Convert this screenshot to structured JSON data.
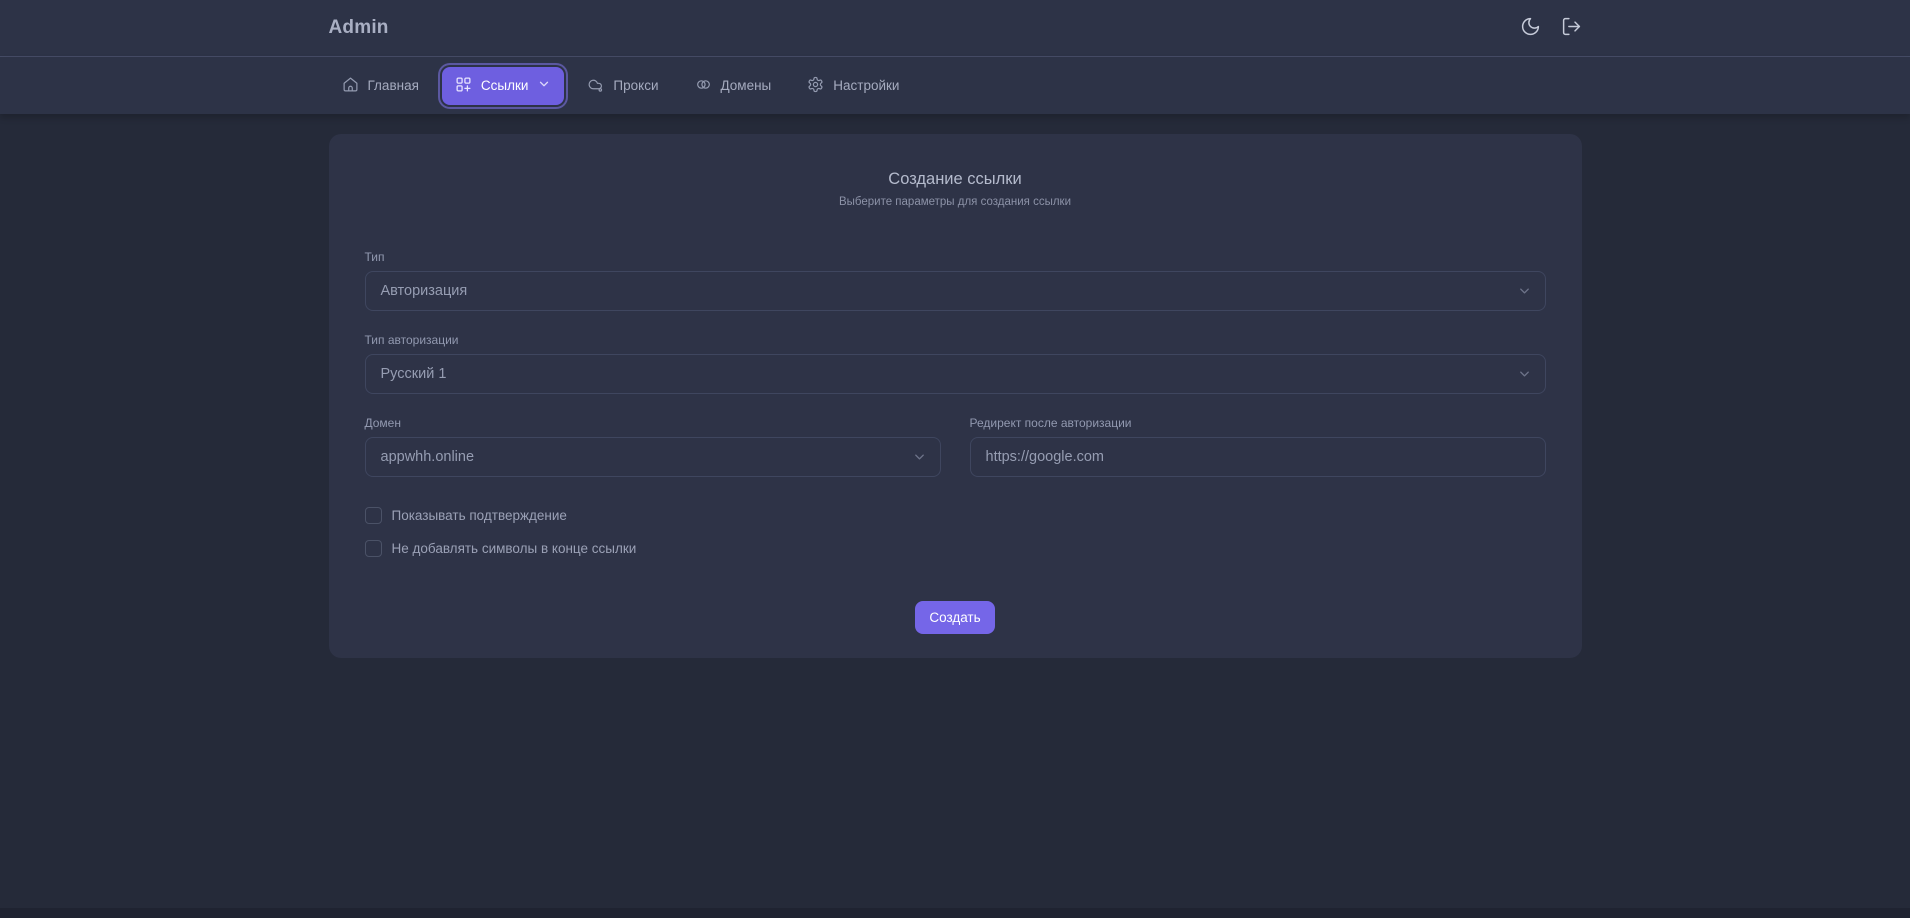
{
  "app": {
    "title": "Admin"
  },
  "topbar": {
    "icons": [
      {
        "name": "moon-icon",
        "action": "toggle-theme"
      },
      {
        "name": "logout-icon",
        "action": "logout"
      }
    ]
  },
  "nav": {
    "items": [
      {
        "label": "Главная",
        "icon": "home-icon",
        "active": false
      },
      {
        "label": "Ссылки",
        "icon": "grid-plus-icon",
        "active": true,
        "has_chevron": true
      },
      {
        "label": "Прокси",
        "icon": "cloud-icon",
        "active": false
      },
      {
        "label": "Домены",
        "icon": "link-circles-icon",
        "active": false
      },
      {
        "label": "Настройки",
        "icon": "gear-icon",
        "active": false
      }
    ]
  },
  "form": {
    "title": "Создание ссылки",
    "subtitle": "Выберите параметры для создания ссылки",
    "fields": {
      "type": {
        "label": "Тип",
        "value": "Авторизация",
        "control": "select"
      },
      "auth_type": {
        "label": "Тип авторизации",
        "value": "Русский 1",
        "control": "select"
      },
      "domain": {
        "label": "Домен",
        "value": "appwhh.online",
        "control": "select"
      },
      "redirect": {
        "label": "Редирект после авторизации",
        "value": "https://google.com",
        "control": "input"
      }
    },
    "checkboxes": [
      {
        "label": "Показывать подтверждение",
        "checked": false
      },
      {
        "label": "Не добавлять символы в конце ссылки",
        "checked": false
      }
    ],
    "submit_label": "Создать"
  },
  "colors": {
    "page_bg": "#252a39",
    "bar_bg": "#2d3347",
    "card_bg": "#2e3347",
    "accent": "#7566e8",
    "nav_active_bg": "#6e5fe0",
    "field_border": "#3f465f",
    "muted_text": "#969db2"
  }
}
